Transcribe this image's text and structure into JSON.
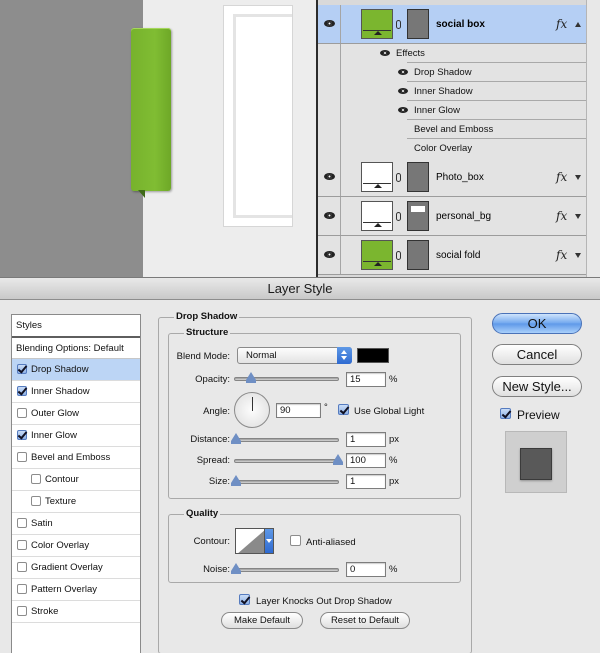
{
  "layers": {
    "items": [
      {
        "name": "social box",
        "selected": true,
        "fx": "fx"
      },
      {
        "name": "Photo_box",
        "selected": false,
        "fx": "fx"
      },
      {
        "name": "personal_bg",
        "selected": false,
        "fx": "fx"
      },
      {
        "name": "social fold",
        "selected": false,
        "fx": "fx"
      }
    ],
    "effects_header": "Effects",
    "effects": [
      "Drop Shadow",
      "Inner Shadow",
      "Inner Glow",
      "Bevel and Emboss",
      "Color Overlay"
    ]
  },
  "dialog": {
    "title": "Layer Style",
    "styles_header": "Styles",
    "blending_options": "Blending Options: Default",
    "style_items": [
      {
        "label": "Drop Shadow",
        "checked": true,
        "active": true
      },
      {
        "label": "Inner Shadow",
        "checked": true
      },
      {
        "label": "Outer Glow",
        "checked": false
      },
      {
        "label": "Inner Glow",
        "checked": true
      },
      {
        "label": "Bevel and Emboss",
        "checked": false
      },
      {
        "label": "Contour",
        "checked": false
      },
      {
        "label": "Texture",
        "checked": false
      },
      {
        "label": "Satin",
        "checked": false
      },
      {
        "label": "Color Overlay",
        "checked": false
      },
      {
        "label": "Gradient Overlay",
        "checked": false
      },
      {
        "label": "Pattern Overlay",
        "checked": false
      },
      {
        "label": "Stroke",
        "checked": false
      }
    ],
    "section_title": "Drop Shadow",
    "structure": {
      "title": "Structure",
      "blend_mode_label": "Blend Mode:",
      "blend_mode_value": "Normal",
      "shadow_color": "#000000",
      "opacity_label": "Opacity:",
      "opacity_value": "15",
      "opacity_fraction": 0.15,
      "percent": "%",
      "angle_label": "Angle:",
      "angle_value": "90",
      "degree": "°",
      "use_global_light": "Use Global Light",
      "distance_label": "Distance:",
      "distance_value": "1",
      "spread_label": "Spread:",
      "spread_value": "100",
      "size_label": "Size:",
      "size_value": "1",
      "px": "px"
    },
    "quality": {
      "title": "Quality",
      "contour_label": "Contour:",
      "anti_aliased": "Anti-aliased",
      "noise_label": "Noise:",
      "noise_value": "0",
      "percent": "%"
    },
    "layer_knocks_out": "Layer Knocks Out Drop Shadow",
    "make_default": "Make Default",
    "reset_to_default": "Reset to Default",
    "buttons": {
      "ok": "OK",
      "cancel": "Cancel",
      "new_style": "New Style...",
      "preview": "Preview"
    }
  },
  "colors": {
    "accent_green": "#7bb62f",
    "selection_blue": "#b5cff4",
    "ok_blue": "#5e98e8"
  }
}
